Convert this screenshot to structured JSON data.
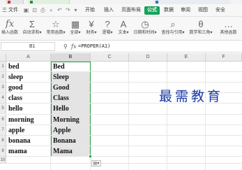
{
  "menubar": {
    "file_label": "三 文件",
    "tabs": [
      "开始",
      "插入",
      "页面布局",
      "公式",
      "数据",
      "审阅",
      "视图",
      "安全"
    ],
    "active_tab": "公式"
  },
  "ribbon": {
    "buttons": [
      {
        "icon": "fx",
        "label": "插入函数"
      },
      {
        "icon": "Σ",
        "label": "自动求和▾"
      },
      {
        "icon": "☆",
        "label": "常用函数▾"
      },
      {
        "icon": "▦",
        "label": "全部▾"
      },
      {
        "icon": "¥",
        "label": "财务▾"
      },
      {
        "icon": "?",
        "label": "逻辑▾"
      },
      {
        "icon": "A",
        "label": "文本▾"
      },
      {
        "icon": "◷",
        "label": "日期和时间▾"
      },
      {
        "icon": "⌕",
        "label": "查找与引用▾"
      },
      {
        "icon": "θ",
        "label": "数学和三角▾"
      },
      {
        "icon": "…",
        "label": "其他函数"
      }
    ]
  },
  "formula_bar": {
    "cell_ref": "B1",
    "zoom_icon": "zoom-icon",
    "fx_label": "fx",
    "formula": "=PROPER(A1)"
  },
  "columns": [
    "A",
    "B",
    "C",
    "D",
    "E",
    "F"
  ],
  "selected_column": "B",
  "rows": [
    {
      "num": "1",
      "a": "bed",
      "b": "Bed"
    },
    {
      "num": "2",
      "a": "sleep",
      "b": "Sleep"
    },
    {
      "num": "3",
      "a": "good",
      "b": "Good"
    },
    {
      "num": "4",
      "a": "class",
      "b": "Class"
    },
    {
      "num": "5",
      "a": "hello",
      "b": "Hello"
    },
    {
      "num": "6",
      "a": "morning",
      "b": "Morning"
    },
    {
      "num": "7",
      "a": "apple",
      "b": "Apple"
    },
    {
      "num": "8",
      "a": "bonana",
      "b": "Bonana"
    },
    {
      "num": "9",
      "a": "mama",
      "b": "Mama"
    },
    {
      "num": "10",
      "a": "",
      "b": ""
    }
  ],
  "paste_options_icon": "paste-options-icon",
  "watermark": "最需教育",
  "colors": {
    "accent_green": "#17a25a",
    "selection_border": "#2a9d45",
    "watermark_blue": "#1a3aa8"
  }
}
